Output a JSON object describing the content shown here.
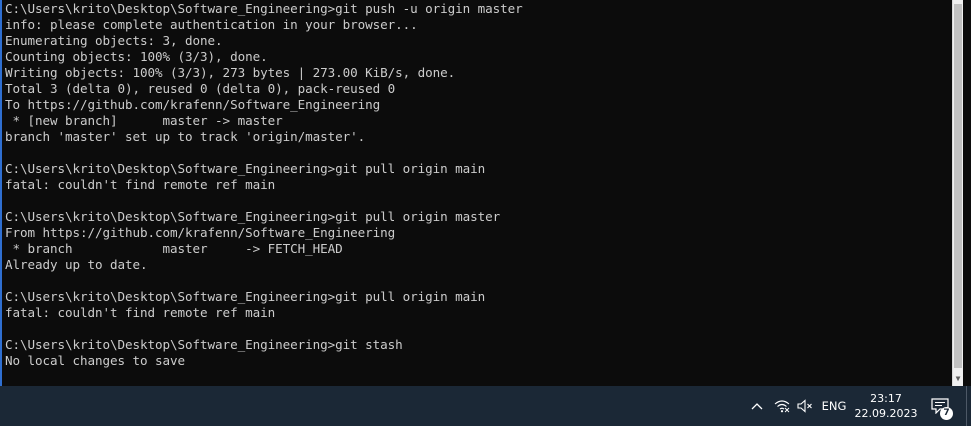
{
  "terminal": {
    "lines": [
      "C:\\Users\\krito\\Desktop\\Software_Engineering>git push -u origin master",
      "info: please complete authentication in your browser...",
      "Enumerating objects: 3, done.",
      "Counting objects: 100% (3/3), done.",
      "Writing objects: 100% (3/3), 273 bytes | 273.00 KiB/s, done.",
      "Total 3 (delta 0), reused 0 (delta 0), pack-reused 0",
      "To https://github.com/krafenn/Software_Engineering",
      " * [new branch]      master -> master",
      "branch 'master' set up to track 'origin/master'.",
      "",
      "C:\\Users\\krito\\Desktop\\Software_Engineering>git pull origin main",
      "fatal: couldn't find remote ref main",
      "",
      "C:\\Users\\krito\\Desktop\\Software_Engineering>git pull origin master",
      "From https://github.com/krafenn/Software_Engineering",
      " * branch            master     -> FETCH_HEAD",
      "Already up to date.",
      "",
      "C:\\Users\\krito\\Desktop\\Software_Engineering>git pull origin main",
      "fatal: couldn't find remote ref main",
      "",
      "C:\\Users\\krito\\Desktop\\Software_Engineering>git stash",
      "No local changes to save"
    ]
  },
  "taskbar": {
    "language": "ENG",
    "time": "23:17",
    "date": "22.09.2023",
    "notification_count": "7"
  },
  "colors": {
    "terminal_bg": "#0c0c0c",
    "terminal_text": "#cccccc",
    "taskbar_bg": "#1b2836"
  }
}
